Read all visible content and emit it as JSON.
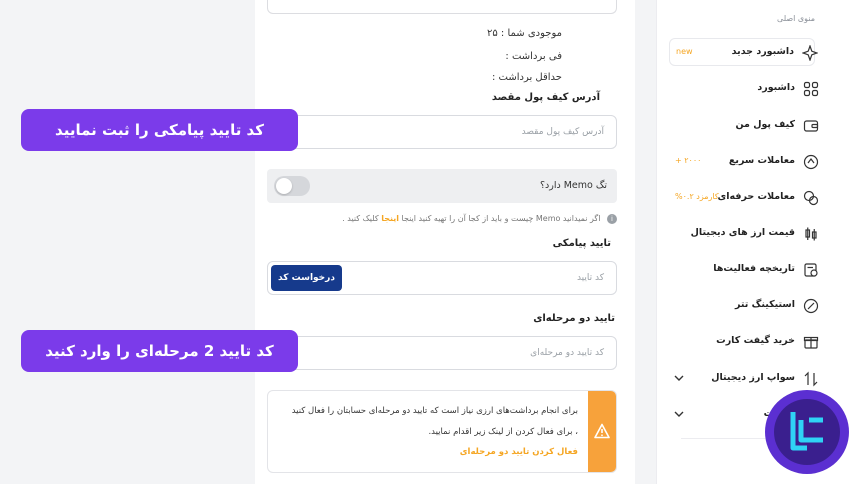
{
  "form": {
    "balance": "موجودی شما : ۲۵",
    "fee": "فی برداشت :",
    "min_withdraw": "حداقل برداشت :",
    "address_label": "آدرس کیف پول مقصد",
    "address_placeholder": "آدرس کیف پول مقصد",
    "memo_label": "تگ Memo دارد؟",
    "memo_enabled": false,
    "memo_info_before": "اگر نمیدانید Memo چیست و باید از کجا آن را تهیه کنید اینجا",
    "memo_info_link": "اینجا",
    "memo_info_after": "کلیک کنید .",
    "sms_label": "تایید پیامکی",
    "sms_placeholder": "کد تایید",
    "sms_button": "درخواست کد",
    "twofa_label": "تایید دو مرحله‌ای",
    "twofa_placeholder": "کد تایید دو مرحله‌ای",
    "warning_line1": "برای انجام برداشت‌های ارزی نیاز است که تایید دو مرحله‌ای حسابتان را فعال کنید",
    "warning_line2": "، برای فعال کردن از لینک زیر اقدام نمایید.",
    "warning_link": "فعال کردن تایید دو مرحله‌ای"
  },
  "banners": {
    "sms": "کد تایید پیامکی را ثبت نمایید",
    "twofa": "کد تایید 2 مرحله‌ای را وارد کنید"
  },
  "sidebar": {
    "header": "منوی اصلی",
    "items": [
      {
        "label": "داشبورد جدید",
        "tag": "new",
        "icon": "sparkle-icon"
      },
      {
        "label": "داشبورد",
        "tag": "",
        "icon": "grid-icon"
      },
      {
        "label": "کیف پول من",
        "tag": "",
        "icon": "wallet-icon"
      },
      {
        "label": "معاملات سریع",
        "tag": "۲۰۰۰ +",
        "icon": "quick-trade-icon"
      },
      {
        "label": "معاملات حرفه‌ای",
        "tag": "کارمزد ۰.۲%",
        "icon": "pro-trade-icon"
      },
      {
        "label": "قیمت ارز های دیجیتال",
        "tag": "",
        "icon": "candle-icon"
      },
      {
        "label": "تاریخچه فعالیت‌ها",
        "tag": "",
        "icon": "history-icon"
      },
      {
        "label": "استیکینگ تتر",
        "tag": "",
        "icon": "staking-icon"
      },
      {
        "label": "خرید گیفت کارت",
        "tag": "",
        "icon": "gift-icon"
      },
      {
        "label": "سواپ ارز دیجیتال",
        "tag": "",
        "icon": "swap-icon"
      },
      {
        "label": "خدمات",
        "tag": "",
        "icon": "services-icon"
      }
    ]
  },
  "colors": {
    "accent": "#7b3bea",
    "primary_button": "#163a8c",
    "warning": "#f7a23b",
    "highlight": "#f5a623"
  }
}
